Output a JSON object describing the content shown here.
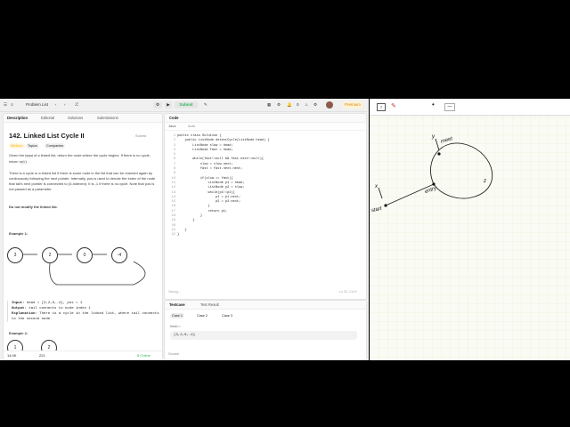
{
  "topbar": {
    "problem_list": "Problem List",
    "run": "▶",
    "submit": "Submit",
    "premium": "Premium",
    "fire_count": "0"
  },
  "left_tabs": [
    "Description",
    "Editorial",
    "Solutions",
    "Submissions"
  ],
  "problem": {
    "title": "142. Linked List Cycle II",
    "solved": "Solved",
    "difficulty": "Medium",
    "topics": "Topics",
    "companies": "Companies",
    "p1_a": "Given the ",
    "p1_code": "head",
    "p1_b": " of a linked list, return the node where the cycle begins. If there is no cycle, return ",
    "p1_code2": "null",
    "p1_c": ".",
    "p2": "There is a cycle in a linked list if there is some node in the list that can be reached again by continuously following the next pointer. Internally, pos is used to denote the index of the node that tail's next pointer is connected to (0-indexed). It is -1 if there is no cycle. Note that pos is not passed as a parameter.",
    "p3": "Do not modify the linked list.",
    "example1": "Example 1:",
    "nodes": [
      "3",
      "2",
      "0",
      "-4"
    ],
    "input_label": "Input:",
    "input_val": "head = [3,2,0,-4], pos = 1",
    "output_label": "Output:",
    "output_val": "tail connects to node index 1",
    "expl_label": "Explanation:",
    "expl_val": "There is a cycle in the linked list, where tail connects to the second node.",
    "example2": "Example 2:",
    "nodes2": [
      "1",
      "2"
    ],
    "likes": "14.0K",
    "comments": "221",
    "online": "8 Online"
  },
  "code_panel": {
    "title": "Code",
    "lang": "Java",
    "auto": "Auto",
    "saving": "Saving...",
    "position": "Ln 20, Col 9",
    "lines": [
      "public class Solution {",
      "    public ListNode detectCycle(ListNode head) {",
      "        ListNode slow = head;",
      "        ListNode fast = head;",
      "",
      "        while(fast!=null && fast.next!=null){",
      "            slow = slow.next;",
      "            fast = fast.next.next;",
      "",
      "            if(slow == fast){",
      "                ListNode p1 = head;",
      "                ListNode p2 = slow;",
      "                while(p1!=p2){",
      "                    p1 = p1.next;",
      "                    p2 = p2.next;",
      "                }",
      "                return p1;",
      "            }",
      "        }",
      "        ",
      "    }",
      "}"
    ]
  },
  "testcase": {
    "tab1": "Testcase",
    "tab2": "Test Result",
    "cases": [
      "Case 1",
      "Case 2",
      "Case 3"
    ],
    "field_label": "head =",
    "field_value": "[3,2,0,-4]",
    "source": "Source"
  },
  "whiteboard": {
    "labels": [
      "start",
      "entry",
      "meet",
      "x",
      "y",
      "z"
    ]
  }
}
